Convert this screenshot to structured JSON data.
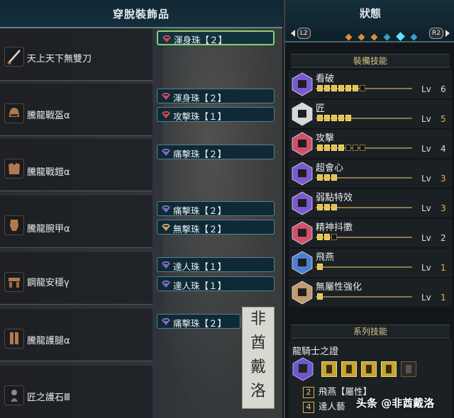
{
  "left_panel": {
    "title": "穿脫裝飾品",
    "equipment": [
      {
        "name": "天上天下無雙刀",
        "icon": "longsword-icon"
      },
      {
        "name": "騰龍戰盔α",
        "icon": "helmet-icon"
      },
      {
        "name": "騰龍戰鎧α",
        "icon": "chest-armor-icon"
      },
      {
        "name": "騰龍腕甲α",
        "icon": "gauntlet-icon"
      },
      {
        "name": "鋼龍安穩γ",
        "icon": "waist-armor-icon"
      },
      {
        "name": "騰龍護腿α",
        "icon": "leg-armor-icon"
      },
      {
        "name": "匠之護石Ⅲ",
        "icon": "charm-icon"
      }
    ],
    "decorations": [
      {
        "label": "渾身珠【２】",
        "color": "#c84a5a",
        "selected": true
      },
      {
        "label": "渾身珠【２】",
        "color": "#c84a5a",
        "selected": false
      },
      {
        "label": "攻擊珠【１】",
        "color": "#c84a5a",
        "selected": false
      },
      {
        "label": "痛擊珠【２】",
        "color": "#7d6ac8",
        "selected": false
      },
      {
        "label": "痛擊珠【２】",
        "color": "#7d6ac8",
        "selected": false
      },
      {
        "label": "無擊珠【２】",
        "color": "#c0a070",
        "selected": false
      },
      {
        "label": "達人珠【１】",
        "color": "#7d6ac8",
        "selected": false
      },
      {
        "label": "達人珠【１】",
        "color": "#7d6ac8",
        "selected": false
      },
      {
        "label": "痛擊珠【２】",
        "color": "#7d6ac8",
        "selected": false
      }
    ],
    "watermark": [
      "非",
      "酋",
      "戴",
      "洛"
    ]
  },
  "right_panel": {
    "title": "狀態",
    "left_button": "L2",
    "right_button": "R2",
    "equipped_skills_header": "裝備技能",
    "skills": [
      {
        "name": "看破",
        "level": 6,
        "max": 7,
        "lv_label": "Lv",
        "hex_color": "#7a5ad0",
        "num_color": "#dcdcdc"
      },
      {
        "name": "匠",
        "level": 5,
        "max": 5,
        "lv_label": "Lv",
        "hex_color": "#d8d8d8",
        "num_color": "#f0b23a"
      },
      {
        "name": "攻擊",
        "level": 4,
        "max": 7,
        "lv_label": "Lv",
        "hex_color": "#d0506a",
        "num_color": "#dcdcdc"
      },
      {
        "name": "超會心",
        "level": 3,
        "max": 3,
        "lv_label": "Lv",
        "hex_color": "#7a5ad0",
        "num_color": "#f0b23a"
      },
      {
        "name": "弱點特效",
        "level": 3,
        "max": 3,
        "lv_label": "Lv",
        "hex_color": "#7a5ad0",
        "num_color": "#f0b23a"
      },
      {
        "name": "精神抖擻",
        "level": 2,
        "max": 3,
        "lv_label": "Lv",
        "hex_color": "#d0506a",
        "num_color": "#dcdcdc"
      },
      {
        "name": "飛燕",
        "level": 1,
        "max": 1,
        "lv_label": "Lv",
        "hex_color": "#4f7fd0",
        "num_color": "#f0b23a"
      },
      {
        "name": "無屬性強化",
        "level": 1,
        "max": 1,
        "lv_label": "Lv",
        "hex_color": "#c09a70",
        "num_color": "#f0b23a"
      }
    ],
    "set_skills_header": "系列技能",
    "set_name": "龍騎士之證",
    "set_pieces_equipped": 4,
    "set_pieces_total": 5,
    "set_bonuses": [
      {
        "pieces": "2",
        "name": "飛燕【屬性】"
      },
      {
        "pieces": "4",
        "name": "達人藝"
      }
    ],
    "brand": "头条 @非酋戴洛"
  }
}
